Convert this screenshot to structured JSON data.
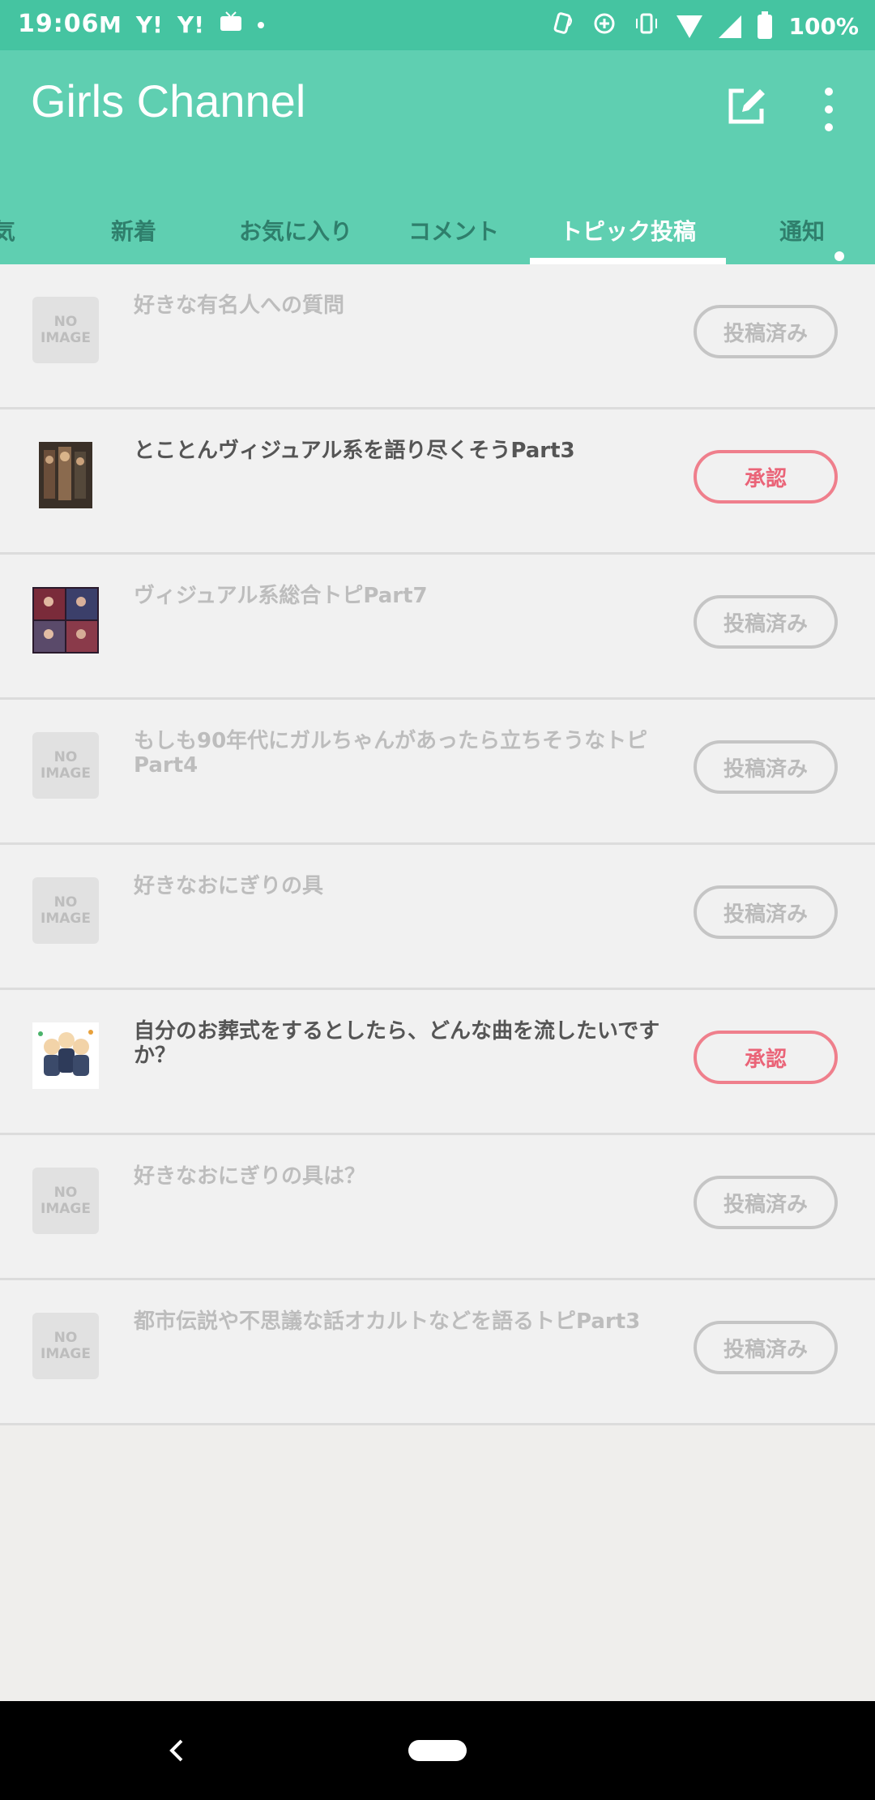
{
  "status_bar": {
    "time": "19:06",
    "left_icons": [
      "M",
      "Y!",
      "Y!"
    ],
    "battery": "100%"
  },
  "app_bar": {
    "title": "Girls Channel"
  },
  "tabs": [
    {
      "label": "気"
    },
    {
      "label": "新着"
    },
    {
      "label": "お気に入り"
    },
    {
      "label": "コメント"
    },
    {
      "label": "トピック投稿"
    },
    {
      "label": "通知"
    }
  ],
  "items": [
    {
      "title": "好きな有名人への質問",
      "thumb_text": "NO\nIMAGE",
      "status": "投稿済み"
    },
    {
      "title": "とことんヴィジュアル系を語り尽くそうPart3",
      "thumb_text": "",
      "status": "承認"
    },
    {
      "title": "ヴィジュアル系総合トピPart7",
      "thumb_text": "",
      "status": "投稿済み"
    },
    {
      "title": "もしも90年代にガルちゃんがあったら立ちそうなトピPart4",
      "thumb_text": "NO\nIMAGE",
      "status": "投稿済み"
    },
    {
      "title": "好きなおにぎりの具",
      "thumb_text": "NO\nIMAGE",
      "status": "投稿済み"
    },
    {
      "title": "自分のお葬式をするとしたら、どんな曲を流したいですか？",
      "thumb_text": "",
      "status": "承認"
    },
    {
      "title": "好きなおにぎりの具は？",
      "thumb_text": "NO\nIMAGE",
      "status": "投稿済み"
    },
    {
      "title": "都市伝説や不思議な話オカルトなどを語るトピPart3",
      "thumb_text": "NO\nIMAGE",
      "status": "投稿済み"
    }
  ],
  "no_image_line1": "NO",
  "no_image_line2": "IMAGE"
}
